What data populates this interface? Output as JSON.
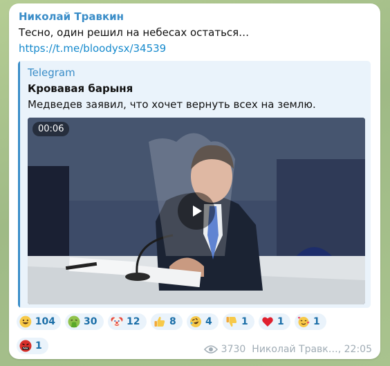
{
  "message": {
    "author": "Николай Травкин",
    "text": "Тесно, один решил на небесах остаться…",
    "link": "https://t.me/bloodysx/34539"
  },
  "forward": {
    "source": "Telegram",
    "title": "Кровавая барыня",
    "description": "Медведев заявил, что хочет вернуть всех на землю.",
    "video": {
      "duration": "00:06",
      "play_icon": "play-icon"
    }
  },
  "reactions": [
    {
      "icon": "grinning-face",
      "count": "104"
    },
    {
      "icon": "vomiting-face",
      "count": "30"
    },
    {
      "icon": "clown-face",
      "count": "12"
    },
    {
      "icon": "thumbs-up",
      "count": "8"
    },
    {
      "icon": "rofl-face",
      "count": "4"
    },
    {
      "icon": "thumbs-down",
      "count": "1"
    },
    {
      "icon": "red-heart",
      "count": "1"
    },
    {
      "icon": "smiling-face-with-hearts",
      "count": "1"
    },
    {
      "icon": "cursing-face",
      "count": "1"
    }
  ],
  "meta": {
    "views": "3730",
    "signature": "Николай Травк…, 22:05",
    "eye_icon": "eye-icon"
  },
  "colors": {
    "accent": "#3a8dc8",
    "link": "#168acd",
    "reaction_bg": "#eaf3fb",
    "bubble": "#ffffff",
    "chat_bg": "#a7c08c"
  }
}
